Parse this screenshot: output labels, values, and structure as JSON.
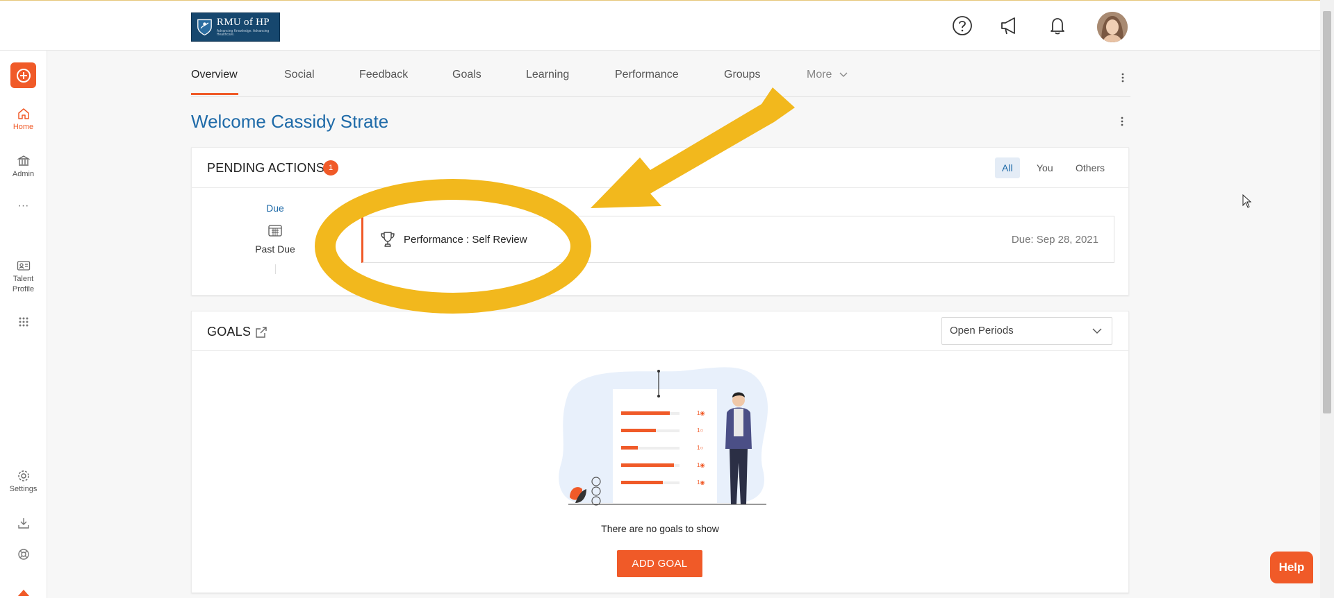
{
  "header": {
    "logo_text": "RMU of HP",
    "logo_tagline": "Advancing Knowledge. Advancing Healthcare.",
    "icons": [
      "help-circle-icon",
      "megaphone-icon",
      "bell-icon"
    ]
  },
  "sidebar": {
    "add_icon": "plus-circle-icon",
    "items": [
      {
        "label": "Home",
        "icon": "home-icon",
        "active": true
      },
      {
        "label": "Admin",
        "icon": "bank-icon",
        "active": false
      },
      {
        "label": "Talent Profile",
        "icon": "id-card-icon",
        "active": false
      },
      {
        "label": "Settings",
        "icon": "gear-icon",
        "active": false
      }
    ],
    "bottom_icons": [
      "download-icon",
      "lifebuoy-icon"
    ]
  },
  "tabs": [
    "Overview",
    "Social",
    "Feedback",
    "Goals",
    "Learning",
    "Performance",
    "Groups",
    "More"
  ],
  "welcome": "Welcome Cassidy Strate",
  "pending": {
    "title": "PENDING ACTIONS",
    "count": "1",
    "filters": [
      "All",
      "You",
      "Others"
    ],
    "active_filter": "All",
    "timeline_label": "Due",
    "timeline_status": "Past Due",
    "item_title": "Performance : Self Review",
    "item_due": "Due: Sep 28, 2021"
  },
  "goals": {
    "title": "GOALS",
    "period_select": "Open Periods",
    "empty_text": "There are no goals to show",
    "add_button": "ADD GOAL"
  },
  "help_label": "Help",
  "colors": {
    "accent": "#f05a28",
    "link_blue": "#1e6aa8",
    "annotation": "#f2b81d",
    "logo_bg": "#16476e"
  }
}
